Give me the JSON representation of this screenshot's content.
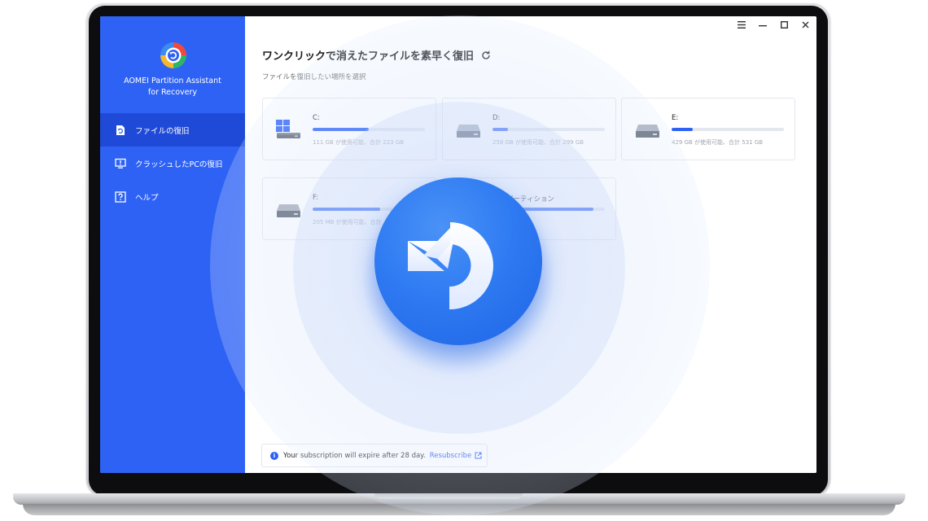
{
  "app": {
    "name_line1": "AOMEI Partition Assistant",
    "name_line2": "for Recovery"
  },
  "sidebar": {
    "items": [
      {
        "label": "ファイルの復旧",
        "icon": "file-restore-icon",
        "active": true
      },
      {
        "label": "クラッシュしたPCの復旧",
        "icon": "crashed-pc-icon",
        "active": false
      },
      {
        "label": "ヘルプ",
        "icon": "help-icon",
        "active": false
      }
    ]
  },
  "window": {
    "controls": [
      "menu-icon",
      "minimize-icon",
      "maximize-icon",
      "close-icon"
    ]
  },
  "main": {
    "title": "ワンクリックで消えたファイルを素早く復旧",
    "subtitle": "ファイルを復旧したい場所を選択"
  },
  "drives": [
    {
      "name": "C:",
      "usage": "111 GB が使用可能、合計 223 GB",
      "used_fraction": 0.5,
      "icon": "windows-drive-icon"
    },
    {
      "name": "D:",
      "usage": "258 GB が使用可能、合計 299 GB",
      "used_fraction": 0.14,
      "icon": "hard-drive-icon"
    },
    {
      "name": "E:",
      "usage": "429 GB が使用可能、合計 531 GB",
      "used_fraction": 0.19,
      "icon": "hard-drive-icon"
    },
    {
      "name": "F:",
      "usage": "205 MB が使用可能、合計",
      "used_fraction": 0.6,
      "icon": "hard-drive-icon"
    },
    {
      "name": "回復パーティション",
      "usage": "",
      "used_fraction": 0.9,
      "icon": "hard-drive-icon"
    }
  ],
  "subscription": {
    "message": "Your subscription will expire after 28 day.",
    "link": "Resubscribe"
  },
  "colors": {
    "sidebar": "#2e62f5",
    "sidebar_active": "#1f4ad8",
    "accent": "#2e62f5",
    "badge": "#2f7bf2"
  }
}
